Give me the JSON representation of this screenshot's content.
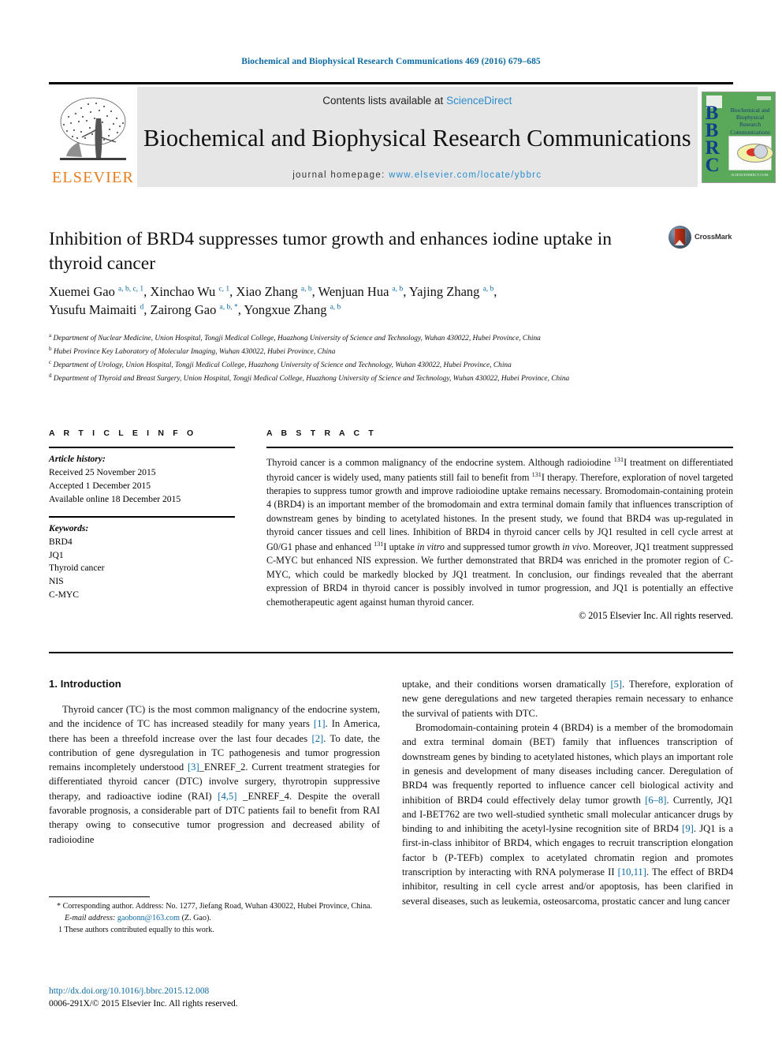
{
  "running_head": "Biochemical and Biophysical Research Communications 469 (2016) 679–685",
  "masthead": {
    "contents_prefix": "Contents lists available at ",
    "sciencedirect": "ScienceDirect",
    "journal_title": "Biochemical and Biophysical Research Communications",
    "homepage_prefix": "journal homepage: ",
    "homepage_url": "www.elsevier.com/locate/ybbrc",
    "publisher": "ELSEVIER",
    "cover": {
      "initials": "BBRC",
      "title_lines": "Biochemical and Biophysical Research Communications",
      "bottom_line": "AVAILABLE ONLINE AT SCIENCEDIRECT.COM"
    }
  },
  "article": {
    "title": "Inhibition of BRD4 suppresses tumor growth and enhances iodine uptake in thyroid cancer",
    "crossmark_label": "CrossMark",
    "authors_line1": "Xuemei Gao a, b, c, 1, Xinchao Wu c, 1, Xiao Zhang a, b, Wenjuan Hua a, b, Yajing Zhang a, b,",
    "authors_line2": "Yusufu Maimaiti d, Zairong Gao a, b, *, Yongxue Zhang a, b",
    "affiliations": [
      "Department of Nuclear Medicine, Union Hospital, Tongji Medical College, Huazhong University of Science and Technology, Wuhan 430022, Hubei Province, China",
      "Hubei Province Key Laboratory of Molecular Imaging, Wuhan 430022, Hubei Province, China",
      "Department of Urology, Union Hospital, Tongji Medical College, Huazhong University of Science and Technology, Wuhan 430022, Hubei Province, China",
      "Department of Thyroid and Breast Surgery, Union Hospital, Tongji Medical College, Huazhong University of Science and Technology, Wuhan 430022, Hubei Province, China"
    ]
  },
  "article_info": {
    "heading": "A R T I C L E   I N F O",
    "history_label": "Article history:",
    "received": "Received 25 November 2015",
    "accepted": "Accepted 1 December 2015",
    "available": "Available online 18 December 2015",
    "keywords_label": "Keywords:",
    "keywords": [
      "BRD4",
      "JQ1",
      "Thyroid cancer",
      "NIS",
      "C-MYC"
    ]
  },
  "abstract": {
    "heading": "A B S T R A C T",
    "text": "Thyroid cancer is a common malignancy of the endocrine system. Although radioiodine 131I treatment on differentiated thyroid cancer is widely used, many patients still fail to benefit from 131I therapy. Therefore, exploration of novel targeted therapies to suppress tumor growth and improve radioiodine uptake remains necessary. Bromodomain-containing protein 4 (BRD4) is an important member of the bromodomain and extra terminal domain family that influences transcription of downstream genes by binding to acetylated histones. In the present study, we found that BRD4 was up-regulated in thyroid cancer tissues and cell lines. Inhibition of BRD4 in thyroid cancer cells by JQ1 resulted in cell cycle arrest at G0/G1 phase and enhanced 131I uptake in vitro and suppressed tumor growth in vivo. Moreover, JQ1 treatment suppressed C-MYC but enhanced NIS expression. We further demonstrated that BRD4 was enriched in the promoter region of C-MYC, which could be markedly blocked by JQ1 treatment. In conclusion, our findings revealed that the aberrant expression of BRD4 in thyroid cancer is possibly involved in tumor progression, and JQ1 is potentially an effective chemotherapeutic agent against human thyroid cancer.",
    "copyright": "© 2015 Elsevier Inc. All rights reserved."
  },
  "body": {
    "section_heading": "1. Introduction",
    "left_paragraph": "Thyroid cancer (TC) is the most common malignancy of the endocrine system, and the incidence of TC has increased steadily for many years [1]. In America, there has been a threefold increase over the last four decades [2]. To date, the contribution of gene dysregulation in TC pathogenesis and tumor progression remains incompletely understood [3]_ENREF_2. Current treatment strategies for differentiated thyroid cancer (DTC) involve surgery, thyrotropin suppressive therapy, and radioactive iodine (RAI) [4,5]_ENREF_4. Despite the overall favorable prognosis, a considerable part of DTC patients fail to benefit from RAI therapy owing to consecutive tumor progression and decreased ability of radioiodine",
    "right_paragraph_1": "uptake, and their conditions worsen dramatically [5]. Therefore, exploration of new gene deregulations and new targeted therapies remain necessary to enhance the survival of patients with DTC.",
    "right_paragraph_2": "Bromodomain-containing protein 4 (BRD4) is a member of the bromodomain and extra terminal domain (BET) family that influences transcription of downstream genes by binding to acetylated histones, which plays an important role in genesis and development of many diseases including cancer. Deregulation of BRD4 was frequently reported to influence cancer cell biological activity and inhibition of BRD4 could effectively delay tumor growth [6–8]. Currently, JQ1 and I-BET762 are two well-studied synthetic small molecular anticancer drugs by binding to and inhibiting the acetyl-lysine recognition site of BRD4 [9]. JQ1 is a first-in-class inhibitor of BRD4, which engages to recruit transcription elongation factor b (P-TEFb) complex to acetylated chromatin region and promotes transcription by interacting with RNA polymerase II [10,11]. The effect of BRD4 inhibitor, resulting in cell cycle arrest and/or apoptosis, has been clarified in several diseases, such as leukemia, osteosarcoma, prostatic cancer and lung cancer"
  },
  "footnotes": {
    "corresponding": "* Corresponding author. Address: No. 1277, Jiefang Road, Wuhan 430022, Hubei Province, China.",
    "email_label": "E-mail address:",
    "email": "gaobonn@163.com",
    "email_suffix": "(Z. Gao).",
    "equal_contribution": "1 These authors contributed equally to this work."
  },
  "doi_block": {
    "doi": "http://dx.doi.org/10.1016/j.bbrc.2015.12.008",
    "issn_line": "0006-291X/© 2015 Elsevier Inc. All rights reserved."
  },
  "colors": {
    "link_blue": "#0b6aa2",
    "sciencedirect_blue": "#2b8ccc",
    "elsevier_orange": "#E87D1E",
    "cover_green": "#5aa85a"
  }
}
